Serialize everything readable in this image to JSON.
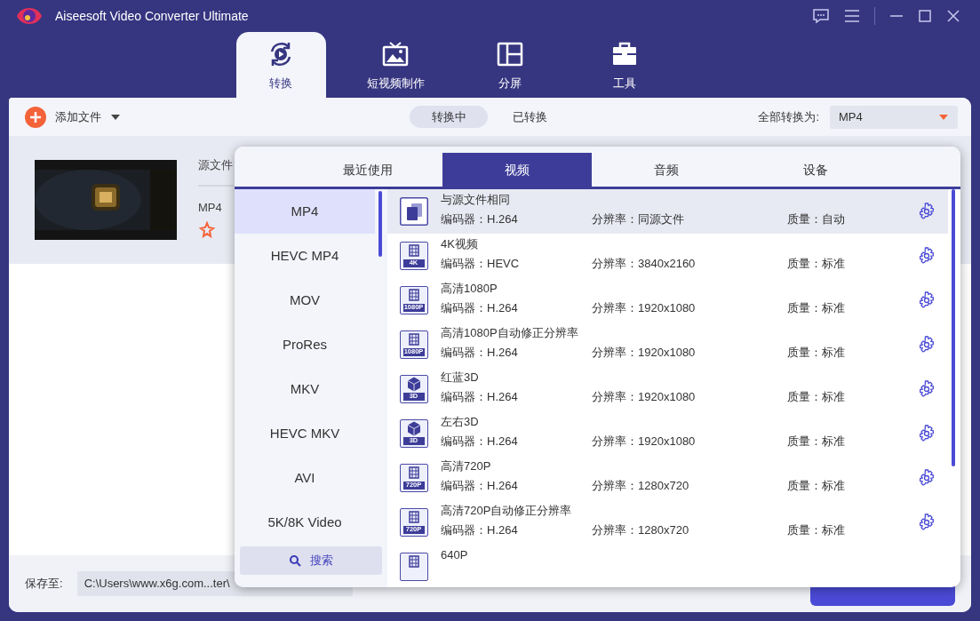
{
  "window": {
    "title": "Aiseesoft Video Converter Ultimate"
  },
  "nav_tabs": [
    {
      "label": "转换",
      "selected": true,
      "kind": "convert"
    },
    {
      "label": "短视频制作",
      "selected": false,
      "kind": "tv"
    },
    {
      "label": "分屏",
      "selected": false,
      "kind": "split"
    },
    {
      "label": "工具",
      "selected": false,
      "kind": "toolbox"
    }
  ],
  "toolbar": {
    "add_file": "添加文件",
    "status_tabs": [
      {
        "label": "转换中",
        "selected": true
      },
      {
        "label": "已转换",
        "selected": false
      }
    ],
    "convert_all_label": "全部转换为:",
    "format_select": "MP4"
  },
  "file": {
    "source_label": "源文件",
    "format": "MP4"
  },
  "format_popup": {
    "tabs": [
      {
        "label": "最近使用",
        "selected": false
      },
      {
        "label": "视频",
        "selected": true
      },
      {
        "label": "音频",
        "selected": false
      },
      {
        "label": "设备",
        "selected": false
      }
    ],
    "formats": [
      {
        "label": "MP4",
        "selected": true
      },
      {
        "label": "HEVC MP4",
        "selected": false
      },
      {
        "label": "MOV",
        "selected": false
      },
      {
        "label": "ProRes",
        "selected": false
      },
      {
        "label": "MKV",
        "selected": false
      },
      {
        "label": "HEVC MKV",
        "selected": false
      },
      {
        "label": "AVI",
        "selected": false
      },
      {
        "label": "5K/8K Video",
        "selected": false
      }
    ],
    "search": "搜索",
    "presets": [
      {
        "title": "与源文件相同",
        "kind": "copy",
        "selected": true,
        "encoder": "编码器：H.264",
        "resolution": "分辨率：同源文件",
        "quality": "质量：自动"
      },
      {
        "title": "4K视频",
        "kind": "film",
        "badge": "4K",
        "selected": false,
        "encoder": "编码器：HEVC",
        "resolution": "分辨率：3840x2160",
        "quality": "质量：标准"
      },
      {
        "title": "高清1080P",
        "kind": "film",
        "badge": "1080P",
        "selected": false,
        "encoder": "编码器：H.264",
        "resolution": "分辨率：1920x1080",
        "quality": "质量：标准"
      },
      {
        "title": "高清1080P自动修正分辨率",
        "kind": "film",
        "badge": "1080P",
        "selected": false,
        "encoder": "编码器：H.264",
        "resolution": "分辨率：1920x1080",
        "quality": "质量：标准"
      },
      {
        "title": "红蓝3D",
        "kind": "cube",
        "badge": "3D",
        "selected": false,
        "encoder": "编码器：H.264",
        "resolution": "分辨率：1920x1080",
        "quality": "质量：标准"
      },
      {
        "title": "左右3D",
        "kind": "cube",
        "badge": "3D",
        "selected": false,
        "encoder": "编码器：H.264",
        "resolution": "分辨率：1920x1080",
        "quality": "质量：标准"
      },
      {
        "title": "高清720P",
        "kind": "film",
        "badge": "720P",
        "selected": false,
        "encoder": "编码器：H.264",
        "resolution": "分辨率：1280x720",
        "quality": "质量：标准"
      },
      {
        "title": "高清720P自动修正分辨率",
        "kind": "film",
        "badge": "720P",
        "selected": false,
        "encoder": "编码器：H.264",
        "resolution": "分辨率：1280x720",
        "quality": "质量：标准"
      },
      {
        "title": "640P",
        "kind": "film",
        "selected": false
      }
    ]
  },
  "bottom_bar": {
    "save_label": "保存至:",
    "path": "C:\\Users\\www.x6g.com...ter\\"
  }
}
